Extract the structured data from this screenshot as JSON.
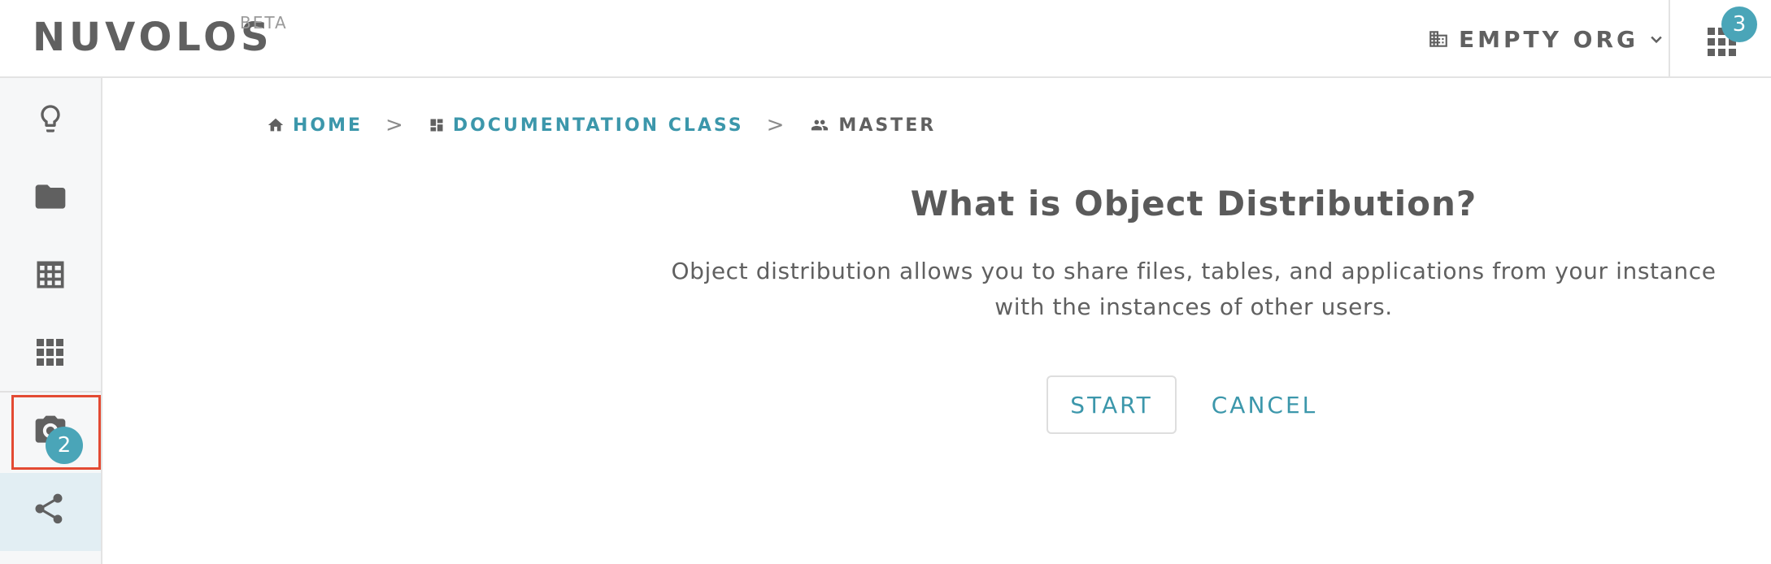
{
  "header": {
    "brand": "NUVOLOS",
    "brand_sup": "BETA",
    "org_name": "EMPTY ORG",
    "apps_badge": "3"
  },
  "sidebar": {
    "items": [
      {
        "icon": "lightbulb-icon"
      },
      {
        "icon": "folder-icon"
      },
      {
        "icon": "table-icon"
      },
      {
        "icon": "apps-grid-icon"
      },
      {
        "icon": "camera-icon"
      },
      {
        "icon": "share-icon",
        "active": true,
        "badge": "2"
      }
    ]
  },
  "breadcrumb": {
    "home": "HOME",
    "space": "DOCUMENTATION CLASS",
    "instance": "MASTER",
    "separator": ">"
  },
  "main": {
    "title": "What is Object Distribution?",
    "description": "Object distribution allows you to share files, tables, and applications from your instance with the instances of other users.",
    "start_label": "START",
    "cancel_label": "CANCEL"
  },
  "colors": {
    "accent": "#3c97ab",
    "badge": "#4aa5b8",
    "highlight": "#e34a33",
    "text": "#606060"
  }
}
